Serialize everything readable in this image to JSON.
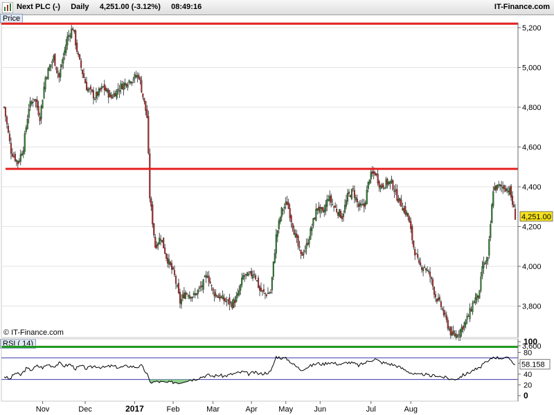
{
  "header": {
    "instrument": "Next PLC (-)",
    "period": "Daily",
    "quote": "4,251.00 (-3.12%)",
    "time": "08:49:16",
    "brand": "IT-Finance.com"
  },
  "price_panel": {
    "label": "Price",
    "watermark": "© IT-Finance.com",
    "last_price_badge": "4,251.00",
    "y_ticks": [
      "5,200",
      "5,000",
      "4,800",
      "4,600",
      "4,400",
      "4,200",
      "4,000",
      "3,800",
      "3,600"
    ]
  },
  "rsi_panel": {
    "label": "RSI ( 14)",
    "y_ticks": [
      "100",
      "80",
      "60",
      "40",
      "20",
      "0"
    ],
    "last_value_badge": "58.158"
  },
  "x_axis": {
    "labels": [
      "Nov",
      "Dec",
      "2017",
      "Feb",
      "Mar",
      "Apr",
      "May",
      "Jun",
      "Jul",
      "Aug"
    ]
  },
  "colors": {
    "candle_up": "#2f7d2f",
    "candle_down": "#b22b2b",
    "resistance_line": "#e52222",
    "support_line": "#1f9a1f",
    "rsi_line": "#000000",
    "rsi_band": "#3a3ab0",
    "rsi_oversold_fill": "#8fcf8f",
    "badge_fill": "#f5e11c"
  },
  "chart_data": [
    {
      "type": "candlestick",
      "ylim": [
        3560,
        5230
      ],
      "x_labels": [
        "Nov",
        "Dec",
        "2017",
        "Feb",
        "Mar",
        "Apr",
        "May",
        "Jun",
        "Jul",
        "Aug"
      ],
      "horizontal_lines": [
        {
          "value": 5220,
          "color": "red"
        },
        {
          "value": 4490,
          "color": "red"
        },
        {
          "value": 3595,
          "color": "green"
        }
      ],
      "last_price": 4251,
      "close_path": [
        [
          0,
          4800
        ],
        [
          5,
          4580
        ],
        [
          10,
          4520
        ],
        [
          14,
          4600
        ],
        [
          18,
          4800
        ],
        [
          22,
          4850
        ],
        [
          26,
          4750
        ],
        [
          30,
          4950
        ],
        [
          36,
          5050
        ],
        [
          40,
          4950
        ],
        [
          46,
          5150
        ],
        [
          50,
          5200
        ],
        [
          54,
          5050
        ],
        [
          60,
          4900
        ],
        [
          66,
          4850
        ],
        [
          72,
          4900
        ],
        [
          78,
          4850
        ],
        [
          84,
          4900
        ],
        [
          92,
          4940
        ],
        [
          98,
          4960
        ],
        [
          104,
          4750
        ],
        [
          106,
          4350
        ],
        [
          110,
          4100
        ],
        [
          114,
          4150
        ],
        [
          118,
          4050
        ],
        [
          124,
          3950
        ],
        [
          128,
          3820
        ],
        [
          132,
          3870
        ],
        [
          138,
          3850
        ],
        [
          144,
          3900
        ],
        [
          148,
          3960
        ],
        [
          152,
          3870
        ],
        [
          156,
          3850
        ],
        [
          160,
          3830
        ],
        [
          166,
          3810
        ],
        [
          170,
          3850
        ],
        [
          174,
          3950
        ],
        [
          178,
          3950
        ],
        [
          182,
          3970
        ],
        [
          186,
          3880
        ],
        [
          190,
          3860
        ],
        [
          194,
          3870
        ],
        [
          198,
          4150
        ],
        [
          202,
          4280
        ],
        [
          206,
          4320
        ],
        [
          212,
          4150
        ],
        [
          216,
          4050
        ],
        [
          220,
          4100
        ],
        [
          224,
          4200
        ],
        [
          228,
          4300
        ],
        [
          232,
          4260
        ],
        [
          236,
          4350
        ],
        [
          240,
          4300
        ],
        [
          246,
          4250
        ],
        [
          250,
          4350
        ],
        [
          254,
          4380
        ],
        [
          258,
          4300
        ],
        [
          262,
          4300
        ],
        [
          266,
          4450
        ],
        [
          270,
          4470
        ],
        [
          274,
          4400
        ],
        [
          278,
          4420
        ],
        [
          282,
          4420
        ],
        [
          286,
          4350
        ],
        [
          290,
          4300
        ],
        [
          294,
          4250
        ],
        [
          298,
          4100
        ],
        [
          302,
          4000
        ],
        [
          306,
          4000
        ],
        [
          310,
          3950
        ],
        [
          314,
          3850
        ],
        [
          318,
          3800
        ],
        [
          322,
          3720
        ],
        [
          326,
          3650
        ],
        [
          330,
          3660
        ],
        [
          334,
          3700
        ],
        [
          338,
          3750
        ],
        [
          342,
          3830
        ],
        [
          346,
          3860
        ],
        [
          348,
          4000
        ],
        [
          352,
          4030
        ],
        [
          356,
          4390
        ],
        [
          360,
          4400
        ],
        [
          364,
          4400
        ],
        [
          368,
          4380
        ],
        [
          372,
          4251
        ]
      ]
    },
    {
      "type": "line",
      "name": "RSI ( 14)",
      "ylim": [
        0,
        100
      ],
      "bands": [
        70,
        30
      ],
      "last_value": 58.158,
      "points": [
        [
          0,
          36
        ],
        [
          4,
          30
        ],
        [
          8,
          42
        ],
        [
          12,
          38
        ],
        [
          16,
          50
        ],
        [
          20,
          48
        ],
        [
          24,
          55
        ],
        [
          28,
          52
        ],
        [
          32,
          58
        ],
        [
          36,
          54
        ],
        [
          40,
          60
        ],
        [
          44,
          55
        ],
        [
          48,
          58
        ],
        [
          52,
          50
        ],
        [
          56,
          55
        ],
        [
          60,
          50
        ],
        [
          66,
          55
        ],
        [
          72,
          52
        ],
        [
          78,
          55
        ],
        [
          84,
          52
        ],
        [
          90,
          55
        ],
        [
          96,
          53
        ],
        [
          100,
          55
        ],
        [
          104,
          40
        ],
        [
          106,
          25
        ],
        [
          112,
          26
        ],
        [
          118,
          24
        ],
        [
          124,
          25
        ],
        [
          128,
          24
        ],
        [
          132,
          28
        ],
        [
          138,
          30
        ],
        [
          144,
          35
        ],
        [
          148,
          38
        ],
        [
          152,
          36
        ],
        [
          156,
          38
        ],
        [
          160,
          36
        ],
        [
          166,
          40
        ],
        [
          170,
          42
        ],
        [
          174,
          44
        ],
        [
          178,
          40
        ],
        [
          182,
          43
        ],
        [
          186,
          40
        ],
        [
          190,
          42
        ],
        [
          194,
          44
        ],
        [
          198,
          72
        ],
        [
          202,
          70
        ],
        [
          206,
          68
        ],
        [
          212,
          55
        ],
        [
          216,
          48
        ],
        [
          220,
          52
        ],
        [
          224,
          56
        ],
        [
          228,
          60
        ],
        [
          232,
          58
        ],
        [
          236,
          62
        ],
        [
          240,
          60
        ],
        [
          246,
          58
        ],
        [
          250,
          62
        ],
        [
          254,
          60
        ],
        [
          258,
          56
        ],
        [
          262,
          60
        ],
        [
          266,
          65
        ],
        [
          270,
          68
        ],
        [
          274,
          62
        ],
        [
          278,
          60
        ],
        [
          282,
          58
        ],
        [
          286,
          55
        ],
        [
          290,
          50
        ],
        [
          294,
          45
        ],
        [
          298,
          40
        ],
        [
          302,
          38
        ],
        [
          306,
          40
        ],
        [
          310,
          36
        ],
        [
          314,
          38
        ],
        [
          318,
          35
        ],
        [
          322,
          33
        ],
        [
          326,
          30
        ],
        [
          330,
          32
        ],
        [
          334,
          38
        ],
        [
          338,
          42
        ],
        [
          342,
          48
        ],
        [
          346,
          50
        ],
        [
          348,
          58
        ],
        [
          352,
          62
        ],
        [
          356,
          72
        ],
        [
          360,
          70
        ],
        [
          364,
          70
        ],
        [
          368,
          68
        ],
        [
          372,
          58
        ]
      ]
    }
  ]
}
